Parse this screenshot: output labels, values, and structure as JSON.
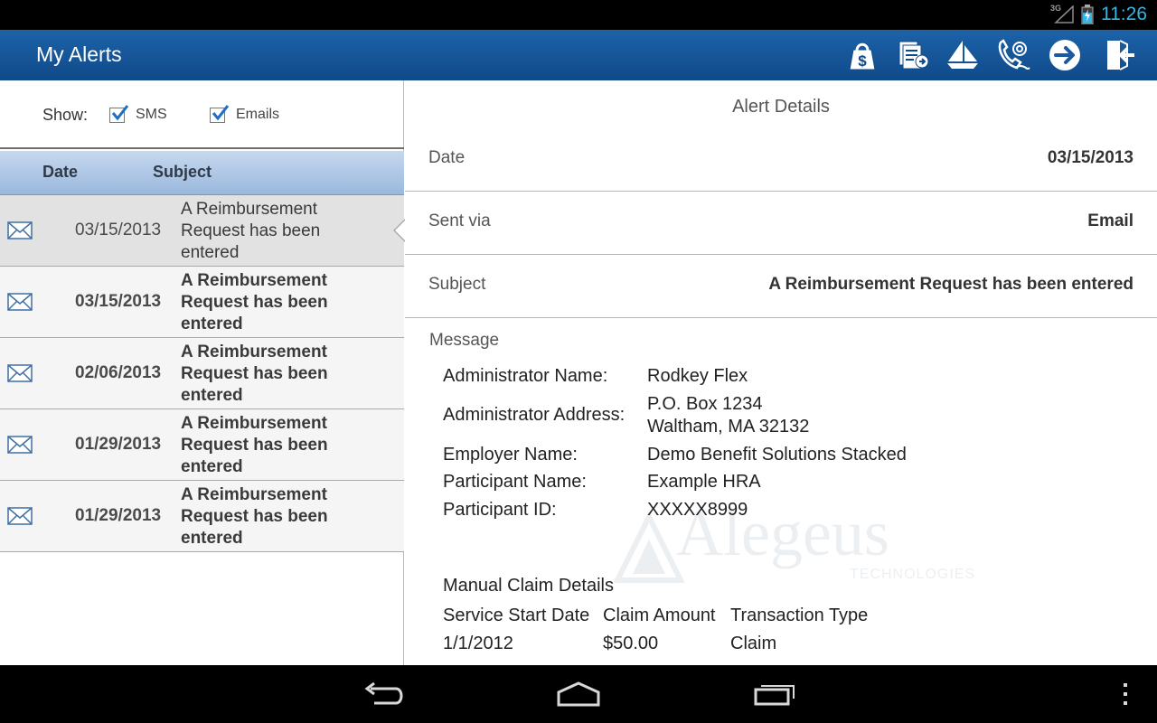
{
  "status_bar": {
    "network_label": "3G",
    "time": "11:26",
    "time_color": "#33b5e5"
  },
  "action_bar": {
    "title": "My Alerts",
    "background": "#1a5aa0",
    "icons": [
      "shopping-bag-dollar-icon",
      "documents-icon",
      "sailboat-icon",
      "phone-at-icon",
      "arrow-right-circle-icon",
      "logout-icon"
    ]
  },
  "filter": {
    "show_label": "Show:",
    "sms": {
      "label": "SMS",
      "checked": true
    },
    "emails": {
      "label": "Emails",
      "checked": true
    }
  },
  "list": {
    "headers": {
      "date": "Date",
      "subject": "Subject"
    },
    "rows": [
      {
        "date": "03/15/2013",
        "subject": "A Reimbursement Request has been entered",
        "read": true,
        "selected": true,
        "icon": "envelope-icon"
      },
      {
        "date": "03/15/2013",
        "subject": "A Reimbursement Request has been entered",
        "read": false,
        "selected": false,
        "icon": "envelope-icon"
      },
      {
        "date": "02/06/2013",
        "subject": "A Reimbursement Request has been entered",
        "read": false,
        "selected": false,
        "icon": "envelope-icon"
      },
      {
        "date": "01/29/2013",
        "subject": "A Reimbursement Request has been entered",
        "read": false,
        "selected": false,
        "icon": "envelope-icon"
      },
      {
        "date": "01/29/2013",
        "subject": "A Reimbursement Request has been entered",
        "read": false,
        "selected": false,
        "icon": "envelope-icon"
      }
    ]
  },
  "details": {
    "title": "Alert Details",
    "date_label": "Date",
    "date_value": "03/15/2013",
    "sent_via_label": "Sent via",
    "sent_via_value": "Email",
    "subject_label": "Subject",
    "subject_value": "A Reimbursement Request has been entered",
    "message_label": "Message",
    "message": {
      "admin_name_label": "Administrator Name:",
      "admin_name": "Rodkey Flex",
      "admin_address_label": "Administrator Address:",
      "admin_address_line1": "P.O. Box 1234",
      "admin_address_line2": "Waltham, MA 32132",
      "employer_name_label": "Employer Name:",
      "employer_name": "Demo Benefit Solutions Stacked",
      "participant_name_label": "Participant Name:",
      "participant_name": "Example HRA",
      "participant_id_label": "Participant ID:",
      "participant_id": "XXXXX8999",
      "claim_section_title": "Manual Claim Details",
      "claim_headers": [
        "Service Start Date",
        "Claim Amount",
        "Transaction Type"
      ],
      "claim_rows": [
        [
          "1/1/2012",
          "$50.00",
          "Claim"
        ]
      ]
    },
    "watermark": {
      "text": "Alegeus",
      "sub": "TECHNOLOGIES"
    }
  },
  "nav_bar": {
    "icons": [
      "back-icon",
      "home-icon",
      "recent-apps-icon",
      "overflow-menu-icon"
    ]
  }
}
